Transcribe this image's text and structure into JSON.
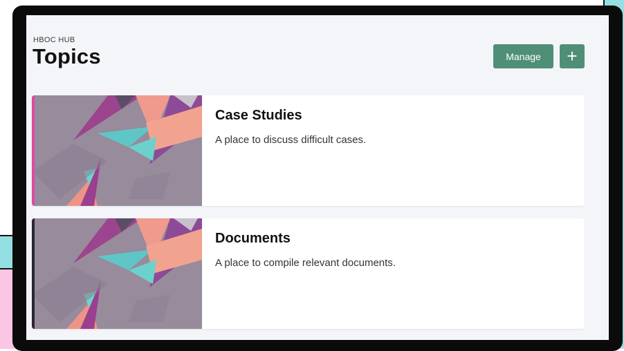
{
  "app": {
    "overline": "HBOC HUB"
  },
  "page": {
    "title": "Topics"
  },
  "toolbar": {
    "manage_label": "Manage",
    "add_label": "+"
  },
  "topics": [
    {
      "title": "Case Studies",
      "description": "A place to discuss difficult cases.",
      "accent_color": "#e04aa0"
    },
    {
      "title": "Documents",
      "description": "A place to compile relevant documents.",
      "accent_color": "#2a2733"
    }
  ],
  "icons": {
    "add": "plus-icon"
  },
  "colors": {
    "primary": "#4f8f78",
    "screen_bg": "#f4f5f9",
    "thumb_bg": "#978b9c"
  }
}
